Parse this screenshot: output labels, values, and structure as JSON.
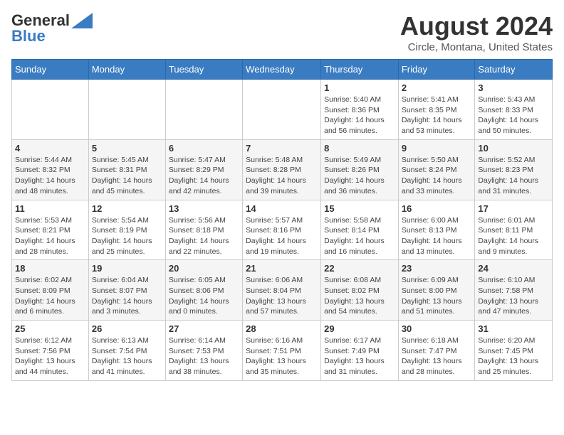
{
  "header": {
    "logo_general": "General",
    "logo_blue": "Blue",
    "title": "August 2024",
    "subtitle": "Circle, Montana, United States"
  },
  "weekdays": [
    "Sunday",
    "Monday",
    "Tuesday",
    "Wednesday",
    "Thursday",
    "Friday",
    "Saturday"
  ],
  "weeks": [
    [
      {
        "day": "",
        "sunrise": "",
        "sunset": "",
        "daylight": ""
      },
      {
        "day": "",
        "sunrise": "",
        "sunset": "",
        "daylight": ""
      },
      {
        "day": "",
        "sunrise": "",
        "sunset": "",
        "daylight": ""
      },
      {
        "day": "",
        "sunrise": "",
        "sunset": "",
        "daylight": ""
      },
      {
        "day": "1",
        "sunrise": "Sunrise: 5:40 AM",
        "sunset": "Sunset: 8:36 PM",
        "daylight": "Daylight: 14 hours and 56 minutes."
      },
      {
        "day": "2",
        "sunrise": "Sunrise: 5:41 AM",
        "sunset": "Sunset: 8:35 PM",
        "daylight": "Daylight: 14 hours and 53 minutes."
      },
      {
        "day": "3",
        "sunrise": "Sunrise: 5:43 AM",
        "sunset": "Sunset: 8:33 PM",
        "daylight": "Daylight: 14 hours and 50 minutes."
      }
    ],
    [
      {
        "day": "4",
        "sunrise": "Sunrise: 5:44 AM",
        "sunset": "Sunset: 8:32 PM",
        "daylight": "Daylight: 14 hours and 48 minutes."
      },
      {
        "day": "5",
        "sunrise": "Sunrise: 5:45 AM",
        "sunset": "Sunset: 8:31 PM",
        "daylight": "Daylight: 14 hours and 45 minutes."
      },
      {
        "day": "6",
        "sunrise": "Sunrise: 5:47 AM",
        "sunset": "Sunset: 8:29 PM",
        "daylight": "Daylight: 14 hours and 42 minutes."
      },
      {
        "day": "7",
        "sunrise": "Sunrise: 5:48 AM",
        "sunset": "Sunset: 8:28 PM",
        "daylight": "Daylight: 14 hours and 39 minutes."
      },
      {
        "day": "8",
        "sunrise": "Sunrise: 5:49 AM",
        "sunset": "Sunset: 8:26 PM",
        "daylight": "Daylight: 14 hours and 36 minutes."
      },
      {
        "day": "9",
        "sunrise": "Sunrise: 5:50 AM",
        "sunset": "Sunset: 8:24 PM",
        "daylight": "Daylight: 14 hours and 33 minutes."
      },
      {
        "day": "10",
        "sunrise": "Sunrise: 5:52 AM",
        "sunset": "Sunset: 8:23 PM",
        "daylight": "Daylight: 14 hours and 31 minutes."
      }
    ],
    [
      {
        "day": "11",
        "sunrise": "Sunrise: 5:53 AM",
        "sunset": "Sunset: 8:21 PM",
        "daylight": "Daylight: 14 hours and 28 minutes."
      },
      {
        "day": "12",
        "sunrise": "Sunrise: 5:54 AM",
        "sunset": "Sunset: 8:19 PM",
        "daylight": "Daylight: 14 hours and 25 minutes."
      },
      {
        "day": "13",
        "sunrise": "Sunrise: 5:56 AM",
        "sunset": "Sunset: 8:18 PM",
        "daylight": "Daylight: 14 hours and 22 minutes."
      },
      {
        "day": "14",
        "sunrise": "Sunrise: 5:57 AM",
        "sunset": "Sunset: 8:16 PM",
        "daylight": "Daylight: 14 hours and 19 minutes."
      },
      {
        "day": "15",
        "sunrise": "Sunrise: 5:58 AM",
        "sunset": "Sunset: 8:14 PM",
        "daylight": "Daylight: 14 hours and 16 minutes."
      },
      {
        "day": "16",
        "sunrise": "Sunrise: 6:00 AM",
        "sunset": "Sunset: 8:13 PM",
        "daylight": "Daylight: 14 hours and 13 minutes."
      },
      {
        "day": "17",
        "sunrise": "Sunrise: 6:01 AM",
        "sunset": "Sunset: 8:11 PM",
        "daylight": "Daylight: 14 hours and 9 minutes."
      }
    ],
    [
      {
        "day": "18",
        "sunrise": "Sunrise: 6:02 AM",
        "sunset": "Sunset: 8:09 PM",
        "daylight": "Daylight: 14 hours and 6 minutes."
      },
      {
        "day": "19",
        "sunrise": "Sunrise: 6:04 AM",
        "sunset": "Sunset: 8:07 PM",
        "daylight": "Daylight: 14 hours and 3 minutes."
      },
      {
        "day": "20",
        "sunrise": "Sunrise: 6:05 AM",
        "sunset": "Sunset: 8:06 PM",
        "daylight": "Daylight: 14 hours and 0 minutes."
      },
      {
        "day": "21",
        "sunrise": "Sunrise: 6:06 AM",
        "sunset": "Sunset: 8:04 PM",
        "daylight": "Daylight: 13 hours and 57 minutes."
      },
      {
        "day": "22",
        "sunrise": "Sunrise: 6:08 AM",
        "sunset": "Sunset: 8:02 PM",
        "daylight": "Daylight: 13 hours and 54 minutes."
      },
      {
        "day": "23",
        "sunrise": "Sunrise: 6:09 AM",
        "sunset": "Sunset: 8:00 PM",
        "daylight": "Daylight: 13 hours and 51 minutes."
      },
      {
        "day": "24",
        "sunrise": "Sunrise: 6:10 AM",
        "sunset": "Sunset: 7:58 PM",
        "daylight": "Daylight: 13 hours and 47 minutes."
      }
    ],
    [
      {
        "day": "25",
        "sunrise": "Sunrise: 6:12 AM",
        "sunset": "Sunset: 7:56 PM",
        "daylight": "Daylight: 13 hours and 44 minutes."
      },
      {
        "day": "26",
        "sunrise": "Sunrise: 6:13 AM",
        "sunset": "Sunset: 7:54 PM",
        "daylight": "Daylight: 13 hours and 41 minutes."
      },
      {
        "day": "27",
        "sunrise": "Sunrise: 6:14 AM",
        "sunset": "Sunset: 7:53 PM",
        "daylight": "Daylight: 13 hours and 38 minutes."
      },
      {
        "day": "28",
        "sunrise": "Sunrise: 6:16 AM",
        "sunset": "Sunset: 7:51 PM",
        "daylight": "Daylight: 13 hours and 35 minutes."
      },
      {
        "day": "29",
        "sunrise": "Sunrise: 6:17 AM",
        "sunset": "Sunset: 7:49 PM",
        "daylight": "Daylight: 13 hours and 31 minutes."
      },
      {
        "day": "30",
        "sunrise": "Sunrise: 6:18 AM",
        "sunset": "Sunset: 7:47 PM",
        "daylight": "Daylight: 13 hours and 28 minutes."
      },
      {
        "day": "31",
        "sunrise": "Sunrise: 6:20 AM",
        "sunset": "Sunset: 7:45 PM",
        "daylight": "Daylight: 13 hours and 25 minutes."
      }
    ]
  ]
}
